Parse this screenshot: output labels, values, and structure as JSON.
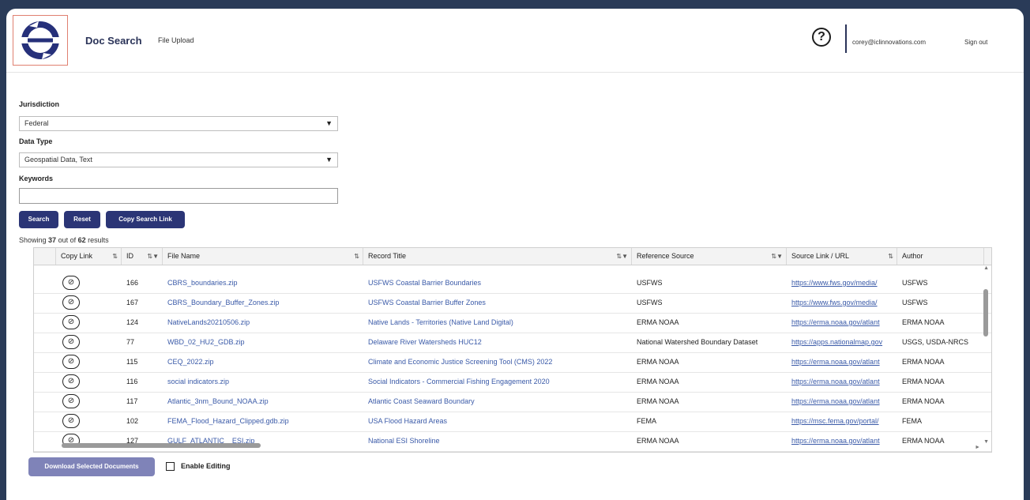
{
  "header": {
    "app_title": "Doc Search",
    "upload_link": "File Upload",
    "help_icon": "?",
    "user_email": "corey@iclinnovations.com",
    "sign_out": "Sign out"
  },
  "filters": {
    "jurisdiction_label": "Jurisdiction",
    "jurisdiction_value": "Federal",
    "data_type_label": "Data Type",
    "data_type_value": "Geospatial Data, Text",
    "keywords_label": "Keywords",
    "keywords_value": ""
  },
  "buttons": {
    "search": "Search",
    "reset": "Reset",
    "copy_link": "Copy Search Link",
    "download": "Download Selected Documents"
  },
  "results": {
    "prefix": "Showing",
    "count": "37",
    "middle": "out of",
    "total": "62",
    "suffix": "results"
  },
  "table": {
    "columns": [
      "Copy Link",
      "ID",
      "File Name",
      "Record Title",
      "Reference Source",
      "Source Link / URL",
      "Author"
    ],
    "rows": [
      {
        "id": "166",
        "file": "CBRS_boundaries.zip",
        "title": "USFWS Coastal Barrier Boundaries",
        "source": "USFWS",
        "url": "https://www.fws.gov/media/",
        "author": "USFWS"
      },
      {
        "id": "167",
        "file": "CBRS_Boundary_Buffer_Zones.zip",
        "title": "USFWS Coastal Barrier Buffer Zones",
        "source": "USFWS",
        "url": "https://www.fws.gov/media/",
        "author": "USFWS"
      },
      {
        "id": "124",
        "file": "NativeLands20210506.zip",
        "title": "Native Lands - Territories (Native Land Digital)",
        "source": "ERMA NOAA",
        "url": "https://erma.noaa.gov/atlant",
        "author": "ERMA NOAA"
      },
      {
        "id": "77",
        "file": "WBD_02_HU2_GDB.zip",
        "title": "Delaware River Watersheds HUC12",
        "source": "National Watershed Boundary Dataset",
        "url": "https://apps.nationalmap.gov",
        "author": "USGS, USDA-NRCS"
      },
      {
        "id": "115",
        "file": "CEQ_2022.zip",
        "title": "Climate and Economic Justice Screening Tool (CMS) 2022",
        "source": "ERMA NOAA",
        "url": "https://erma.noaa.gov/atlant",
        "author": "ERMA NOAA"
      },
      {
        "id": "116",
        "file": "social indicators.zip",
        "title": "Social Indicators - Commercial Fishing Engagement 2020",
        "source": "ERMA NOAA",
        "url": "https://erma.noaa.gov/atlant",
        "author": "ERMA NOAA"
      },
      {
        "id": "117",
        "file": "Atlantic_3nm_Bound_NOAA.zip",
        "title": "Atlantic Coast Seaward Boundary",
        "source": "ERMA NOAA",
        "url": "https://erma.noaa.gov/atlant",
        "author": "ERMA NOAA"
      },
      {
        "id": "102",
        "file": "FEMA_Flood_Hazard_Clipped.gdb.zip",
        "title": "USA Flood Hazard Areas",
        "source": "FEMA",
        "url": "https://msc.fema.gov/portal/",
        "author": "FEMA"
      },
      {
        "id": "127",
        "file": "GULF_ATLANTIC__ESI.zip",
        "title": "National ESI Shoreline",
        "source": "ERMA NOAA",
        "url": "https://erma.noaa.gov/atlant",
        "author": "ERMA NOAA"
      }
    ]
  },
  "editing": {
    "label": "Enable Editing",
    "checked": false
  },
  "icons": {
    "logo": "circular-arrows-logo",
    "copy": "link-icon",
    "dropdown": "caret-down-icon",
    "filter": "filter-icon"
  }
}
